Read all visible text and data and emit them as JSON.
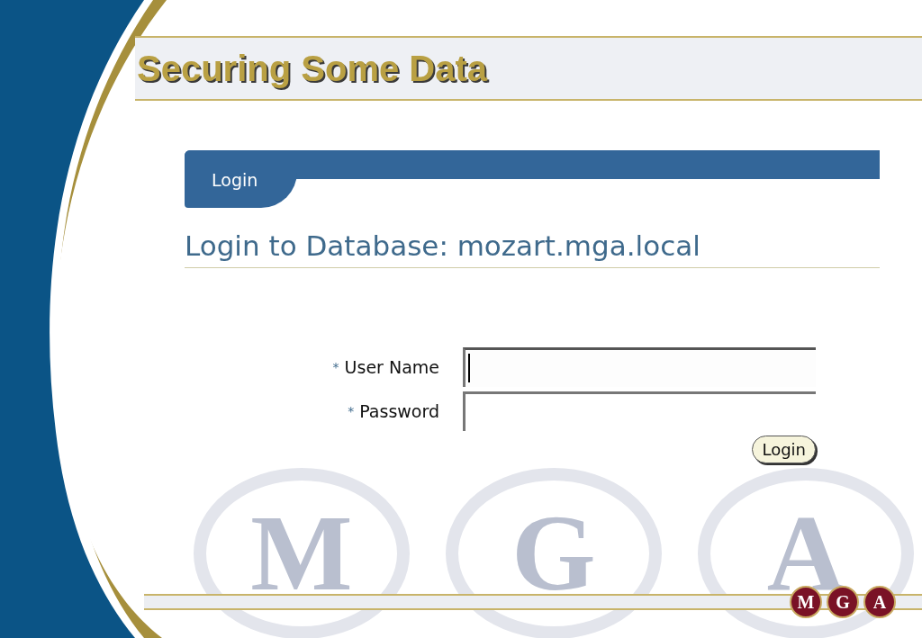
{
  "slide": {
    "title": "Securing Some Data"
  },
  "screen": {
    "tabs": [
      {
        "label": "Login",
        "selected": true
      }
    ],
    "heading": "Login to Database: mozart.mga.local",
    "fields": [
      {
        "required_mark": "*",
        "label": "User Name",
        "focused": true
      },
      {
        "required_mark": "*",
        "label": "Password",
        "focused": false
      }
    ],
    "button": "Login"
  },
  "background_letters": [
    "M",
    "G",
    "A"
  ],
  "logo": [
    "M",
    "G",
    "A"
  ]
}
